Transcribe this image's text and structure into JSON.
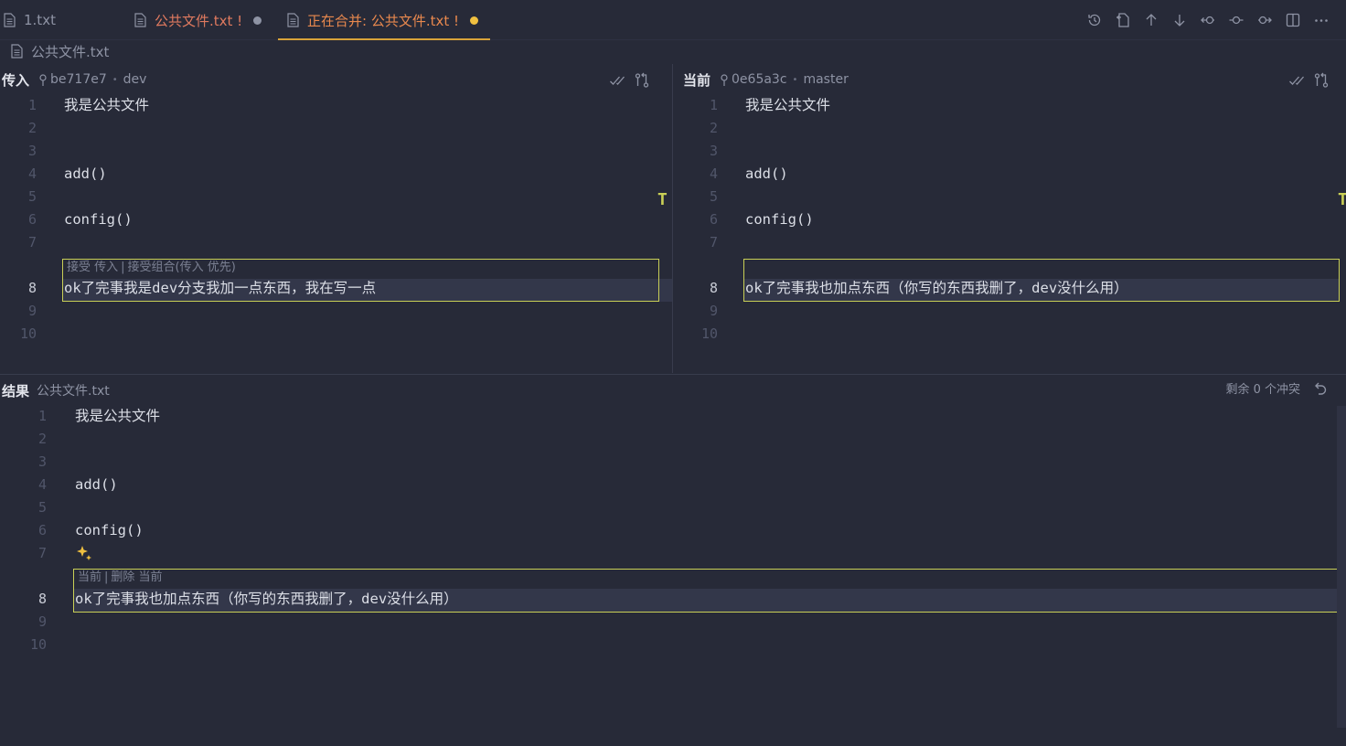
{
  "tabs": [
    {
      "label": "1.txt",
      "icon": "file-icon"
    },
    {
      "label": "公共文件.txt !",
      "icon": "file-icon",
      "dirty": true
    },
    {
      "label": "正在合并: 公共文件.txt !",
      "icon": "file-icon",
      "dirty": true,
      "active": true
    }
  ],
  "toolbar": {
    "icons": [
      "history-icon",
      "open-file-icon",
      "arrow-up-icon",
      "arrow-down-icon",
      "previous-change-icon",
      "commit-icon",
      "next-change-icon",
      "split-editor-icon",
      "more-actions-icon"
    ]
  },
  "breadcrumb": {
    "file": "公共文件.txt"
  },
  "incoming": {
    "title": "传入",
    "commit": "be717e7",
    "branch": "dev",
    "lines": [
      "我是公共文件",
      "",
      "",
      "add()",
      "",
      "config()",
      "",
      "ok了完事我是dev分支我加一点东西，我在写一点",
      "",
      ""
    ],
    "line_numbers": [
      "1",
      "2",
      "3",
      "4",
      "5",
      "6",
      "7",
      "8",
      "9",
      "10"
    ],
    "codelens": {
      "accept": "接受 传入",
      "accept_combo": "接受组合(传入 优先)"
    }
  },
  "current": {
    "title": "当前",
    "commit": "0e65a3c",
    "branch": "master",
    "lines": [
      "我是公共文件",
      "",
      "",
      "add()",
      "",
      "config()",
      "",
      "ok了完事我也加点东西（你写的东西我删了，dev没什么用）",
      "",
      ""
    ],
    "line_numbers": [
      "1",
      "2",
      "3",
      "4",
      "5",
      "6",
      "7",
      "8",
      "9",
      "10"
    ]
  },
  "result": {
    "title": "结果",
    "file": "公共文件.txt",
    "conflicts_remaining": "剩余 0 个冲突",
    "lines": [
      "我是公共文件",
      "",
      "",
      "add()",
      "",
      "config()",
      "",
      "ok了完事我也加点东西（你写的东西我删了，dev没什么用）",
      "",
      ""
    ],
    "line_numbers": [
      "1",
      "2",
      "3",
      "4",
      "5",
      "6",
      "7",
      "8",
      "9",
      "10"
    ],
    "codelens": {
      "current": "当前",
      "remove": "删除 当前"
    }
  },
  "minimap_marker": "T",
  "colors": {
    "accent": "#c9cf56",
    "tab_dirty": "#e07a5f",
    "tab_active_text": "#e8884e",
    "dot_active": "#f0c040"
  }
}
